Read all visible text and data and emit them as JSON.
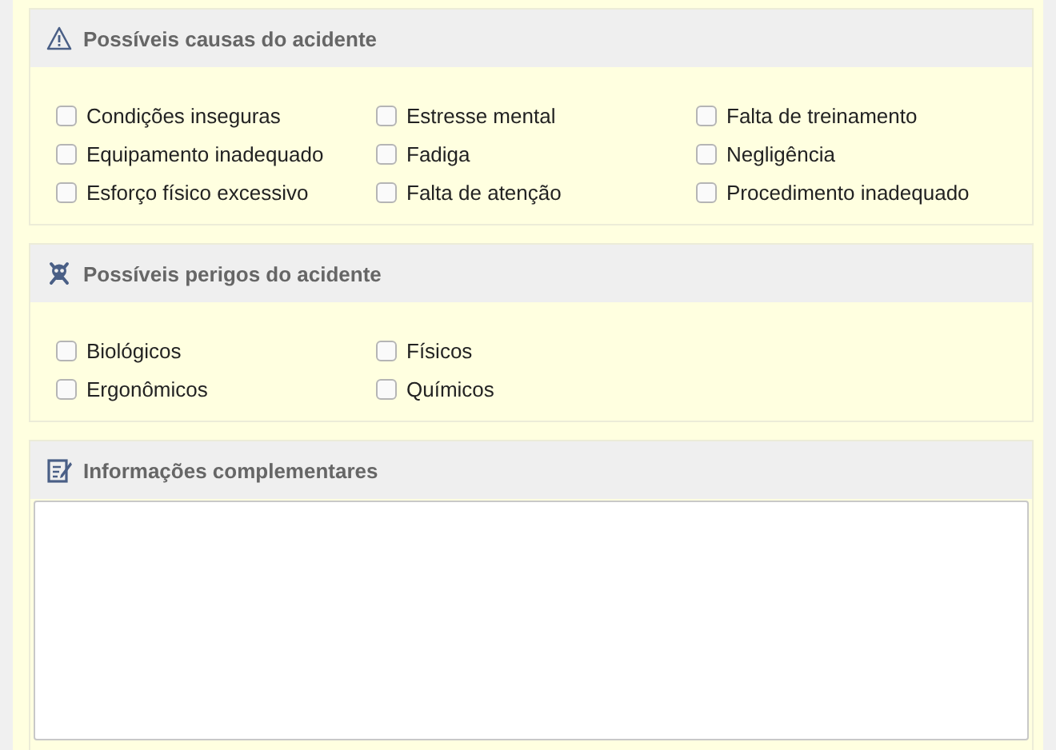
{
  "sections": [
    {
      "kind": "checklist",
      "title": "Possíveis causas do acidente",
      "columns": [
        [
          {
            "label": "Condições inseguras",
            "checked": false
          },
          {
            "label": "Equipamento inadequado",
            "checked": false
          },
          {
            "label": "Esforço físico excessivo",
            "checked": false
          }
        ],
        [
          {
            "label": "Estresse mental",
            "checked": false
          },
          {
            "label": "Fadiga",
            "checked": false
          },
          {
            "label": "Falta de atenção",
            "checked": false
          }
        ],
        [
          {
            "label": "Falta de treinamento",
            "checked": false
          },
          {
            "label": "Negligência",
            "checked": false
          },
          {
            "label": "Procedimento inadequado",
            "checked": false
          }
        ]
      ]
    },
    {
      "kind": "checklist",
      "title": "Possíveis perigos do acidente",
      "columns": [
        [
          {
            "label": "Biológicos",
            "checked": false
          },
          {
            "label": "Ergonômicos",
            "checked": false
          }
        ],
        [
          {
            "label": "Físicos",
            "checked": false
          },
          {
            "label": "Químicos",
            "checked": false
          }
        ]
      ]
    },
    {
      "kind": "textarea",
      "title": "Informações complementares"
    }
  ]
}
